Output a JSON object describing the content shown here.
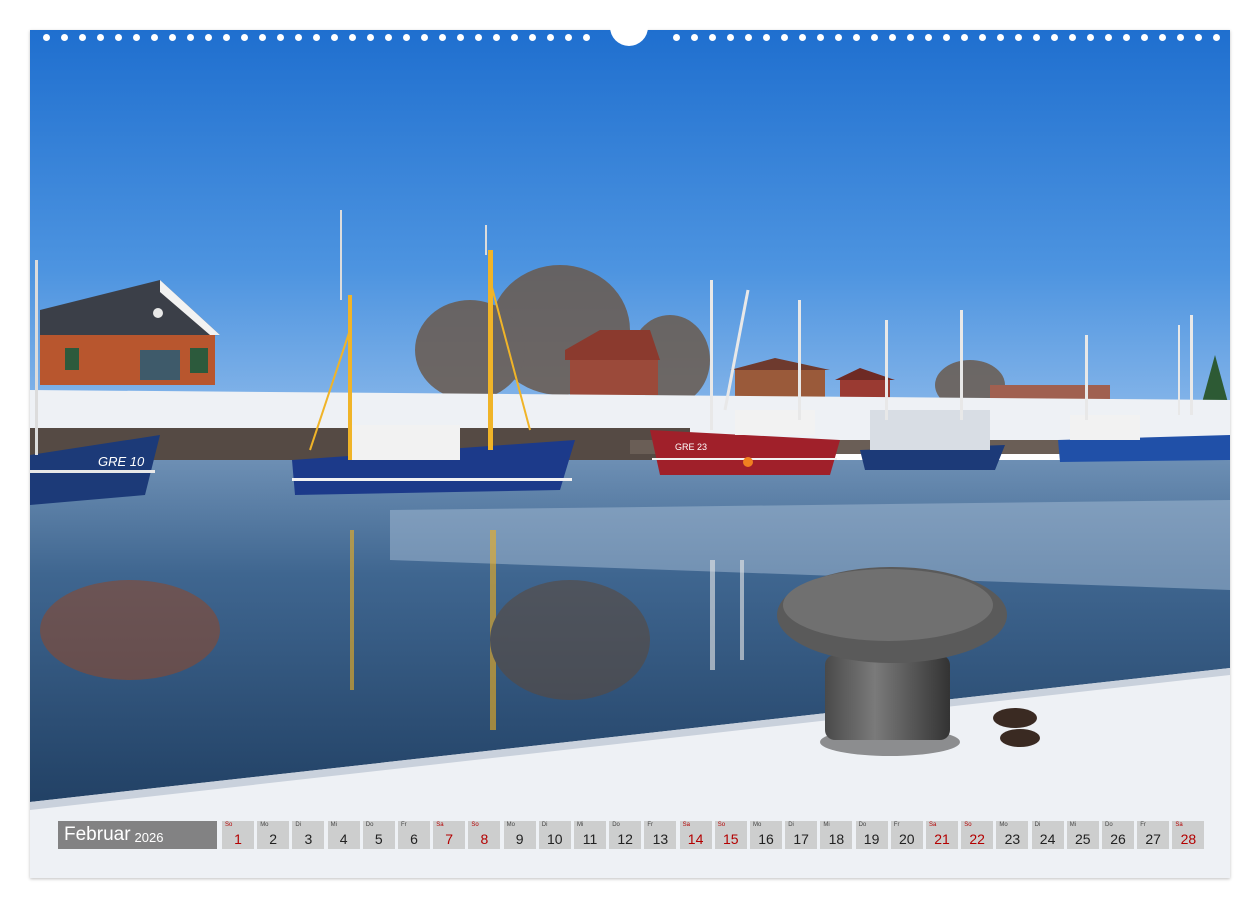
{
  "calendar": {
    "month": "Februar",
    "year": "2026",
    "weekend_color": "#b30000",
    "days": [
      {
        "wd": "So",
        "n": "1",
        "red": true
      },
      {
        "wd": "Mo",
        "n": "2",
        "red": false
      },
      {
        "wd": "Di",
        "n": "3",
        "red": false
      },
      {
        "wd": "Mi",
        "n": "4",
        "red": false
      },
      {
        "wd": "Do",
        "n": "5",
        "red": false
      },
      {
        "wd": "Fr",
        "n": "6",
        "red": false
      },
      {
        "wd": "Sa",
        "n": "7",
        "red": true
      },
      {
        "wd": "So",
        "n": "8",
        "red": true
      },
      {
        "wd": "Mo",
        "n": "9",
        "red": false
      },
      {
        "wd": "Di",
        "n": "10",
        "red": false
      },
      {
        "wd": "Mi",
        "n": "11",
        "red": false
      },
      {
        "wd": "Do",
        "n": "12",
        "red": false
      },
      {
        "wd": "Fr",
        "n": "13",
        "red": false
      },
      {
        "wd": "Sa",
        "n": "14",
        "red": true
      },
      {
        "wd": "So",
        "n": "15",
        "red": true
      },
      {
        "wd": "Mo",
        "n": "16",
        "red": false
      },
      {
        "wd": "Di",
        "n": "17",
        "red": false
      },
      {
        "wd": "Mi",
        "n": "18",
        "red": false
      },
      {
        "wd": "Do",
        "n": "19",
        "red": false
      },
      {
        "wd": "Fr",
        "n": "20",
        "red": false
      },
      {
        "wd": "Sa",
        "n": "21",
        "red": true
      },
      {
        "wd": "So",
        "n": "22",
        "red": true
      },
      {
        "wd": "Mo",
        "n": "23",
        "red": false
      },
      {
        "wd": "Di",
        "n": "24",
        "red": false
      },
      {
        "wd": "Mi",
        "n": "25",
        "red": false
      },
      {
        "wd": "Do",
        "n": "26",
        "red": false
      },
      {
        "wd": "Fr",
        "n": "27",
        "red": false
      },
      {
        "wd": "Sa",
        "n": "28",
        "red": true
      }
    ]
  },
  "photo": {
    "boat_labels": [
      "GRE 10",
      "GRE 23"
    ]
  }
}
